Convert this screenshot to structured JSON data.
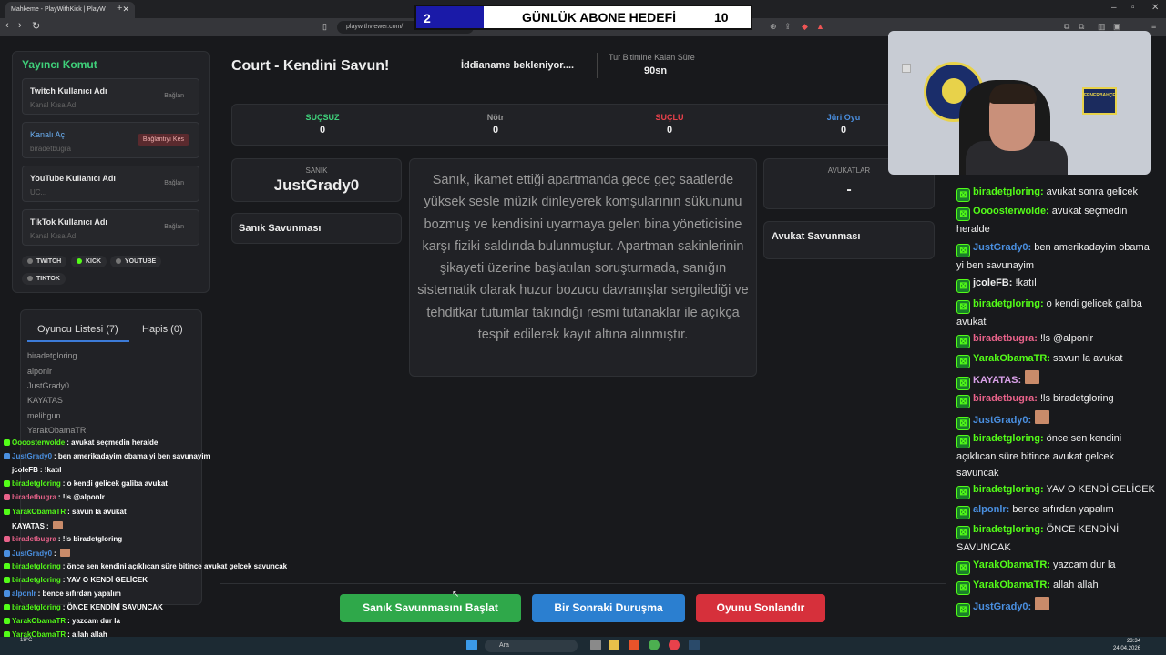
{
  "browser": {
    "tab_title": "Mahkeme - PlayWithKick | PlayW",
    "url": "playwithviewer.com/"
  },
  "goal": {
    "current": "2",
    "title": "GÜNLÜK ABONE HEDEFİ",
    "target": "10"
  },
  "left_panel": {
    "title": "Yayıncı Komut",
    "accounts": [
      {
        "label": "Twitch Kullanıcı Adı",
        "sub": "Kanal Kısa Adı",
        "button": "Bağlan"
      },
      {
        "label": "Kanalı Aç",
        "sub": "biradetbugra",
        "button": "Bağlantıyı Kes"
      },
      {
        "label": "YouTube Kullanıcı Adı",
        "sub": "UC...",
        "button": "Bağlan"
      },
      {
        "label": "TikTok Kullanıcı Adı",
        "sub": "Kanal Kısa Adı",
        "button": "Bağlan"
      }
    ],
    "platforms": [
      "TWITCH",
      "KICK",
      "YOUTUBE",
      "TIKTOK"
    ]
  },
  "players": {
    "tab_list": "Oyuncu Listesi (7)",
    "tab_jail": "Hapis (0)",
    "names": [
      "biradetgloring",
      "alponlr",
      "JustGrady0",
      "KAYATAS",
      "melihgun",
      "YarakObamaTR"
    ]
  },
  "game": {
    "title": "Court - Kendini Savun!",
    "status": "İddianame bekleniyor....",
    "timer_label": "Tur Bitimine Kalan Süre",
    "timer_value": "90sn"
  },
  "votes": [
    {
      "label": "SUÇSUZ",
      "value": "0",
      "color": "#3fd07a"
    },
    {
      "label": "Nötr",
      "value": "0",
      "color": "#999999"
    },
    {
      "label": "SUÇLU",
      "value": "0",
      "color": "#e8414b"
    },
    {
      "label": "Jüri Oyu",
      "value": "0",
      "color": "#4a8fe0"
    }
  ],
  "defendant": {
    "label": "SANIK",
    "name": "JustGrady0",
    "defense": "Sanık Savunması"
  },
  "case_text": "Sanık, ikamet ettiği apartmanda gece geç saatlerde yüksek sesle müzik dinleyerek komşularının sükununu bozmuş ve kendisini uyarmaya gelen bina yöneticisine karşı fiziki saldırıda bulunmuştur. Apartman sakinlerinin şikayeti üzerine başlatılan soruşturmada, sanığın sistematik olarak huzur bozucu davranışlar sergilediği ve tehditkar tutumlar takındığı resmi tutanaklar ile açıkça tespit edilerek kayıt altına alınmıştır.",
  "lawyers": {
    "label": "AVUKATLAR",
    "value": "-",
    "defense": "Avukat Savunması"
  },
  "actions": {
    "start": "Sanık Savunmasını Başlat",
    "next": "Bir Sonraki Duruşma",
    "end": "Oyunu Sonlandır"
  },
  "overlay_chat": [
    {
      "name": "Oooosterwolde",
      "msg": ": avukat seçmedin heralde",
      "color": "#53fc18"
    },
    {
      "name": "JustGrady0",
      "msg": ": ben amerikadayim obama yi ben savunayim",
      "color": "#4a8fe0"
    },
    {
      "name": "jcoleFB",
      "msg": ": !katıl",
      "color": "#ffffff"
    },
    {
      "name": "biradetgloring",
      "msg": ": o kendi gelicek galiba avukat",
      "color": "#53fc18"
    },
    {
      "name": "biradetbugra",
      "msg": ": !ls @alponlr",
      "color": "#e8628a"
    },
    {
      "name": "YarakObamaTR",
      "msg": ": savun la avukat",
      "color": "#53fc18"
    },
    {
      "name": "KAYATAS",
      "msg": ":",
      "color": "#ffffff"
    },
    {
      "name": "biradetbugra",
      "msg": ": !ls biradetgloring",
      "color": "#e8628a"
    },
    {
      "name": "JustGrady0",
      "msg": ":",
      "color": "#4a8fe0"
    },
    {
      "name": "biradetgloring",
      "msg": ": önce sen kendini açıklıcan süre bitince avukat gelcek savuncak",
      "color": "#53fc18"
    },
    {
      "name": "biradetgloring",
      "msg": ": YAV O KENDİ GELİCEK",
      "color": "#53fc18"
    },
    {
      "name": "alponlr",
      "msg": ": bence sıfırdan yapalım",
      "color": "#4a8fe0"
    },
    {
      "name": "biradetgloring",
      "msg": ": ÖNCE KENDİNİ SAVUNCAK",
      "color": "#53fc18"
    },
    {
      "name": "YarakObamaTR",
      "msg": ": yazcam dur la",
      "color": "#53fc18"
    },
    {
      "name": "YarakObamaTR",
      "msg": ": allah allah",
      "color": "#53fc18"
    }
  ],
  "right_chat": [
    {
      "name": "biradetgloring:",
      "msg": " avukat sonra gelicek",
      "color": "#53fc18"
    },
    {
      "name": "Oooosterwolde:",
      "msg": " avukat seçmedin heralde",
      "color": "#53fc18"
    },
    {
      "name": "JustGrady0:",
      "msg": " ben amerikadayim obama yi ben savunayim",
      "color": "#4a8fe0"
    },
    {
      "name": "jcoleFB:",
      "msg": " !katıl",
      "color": "#eeeeee"
    },
    {
      "name": "biradetgloring:",
      "msg": " o kendi gelicek galiba avukat",
      "color": "#53fc18"
    },
    {
      "name": "biradetbugra:",
      "msg": " !ls @alponlr",
      "color": "#e8628a"
    },
    {
      "name": "YarakObamaTR:",
      "msg": " savun la avukat",
      "color": "#53fc18"
    },
    {
      "name": "KAYATAS:",
      "msg": "",
      "color": "#d9a0e8"
    },
    {
      "name": "biradetbugra:",
      "msg": " !ls biradetgloring",
      "color": "#e8628a"
    },
    {
      "name": "JustGrady0:",
      "msg": "",
      "color": "#4a8fe0"
    },
    {
      "name": "biradetgloring:",
      "msg": " önce sen kendini açıklıcan süre bitince avukat gelcek savuncak",
      "color": "#53fc18"
    },
    {
      "name": "biradetgloring:",
      "msg": " YAV O KENDİ GELİCEK",
      "color": "#53fc18"
    },
    {
      "name": "alponlr:",
      "msg": " bence sıfırdan yapalım",
      "color": "#4a8fe0"
    },
    {
      "name": "biradetgloring:",
      "msg": " ÖNCE KENDİNİ SAVUNCAK",
      "color": "#53fc18"
    },
    {
      "name": "YarakObamaTR:",
      "msg": " yazcam dur la",
      "color": "#53fc18"
    },
    {
      "name": "YarakObamaTR:",
      "msg": " allah allah",
      "color": "#53fc18"
    },
    {
      "name": "JustGrady0:",
      "msg": "",
      "color": "#4a8fe0"
    }
  ],
  "taskbar": {
    "search": "Ara",
    "time": "23:34",
    "date": "24.04.2026",
    "weather": "18°C"
  },
  "cam": {
    "poster": "FENERBAHÇE"
  }
}
